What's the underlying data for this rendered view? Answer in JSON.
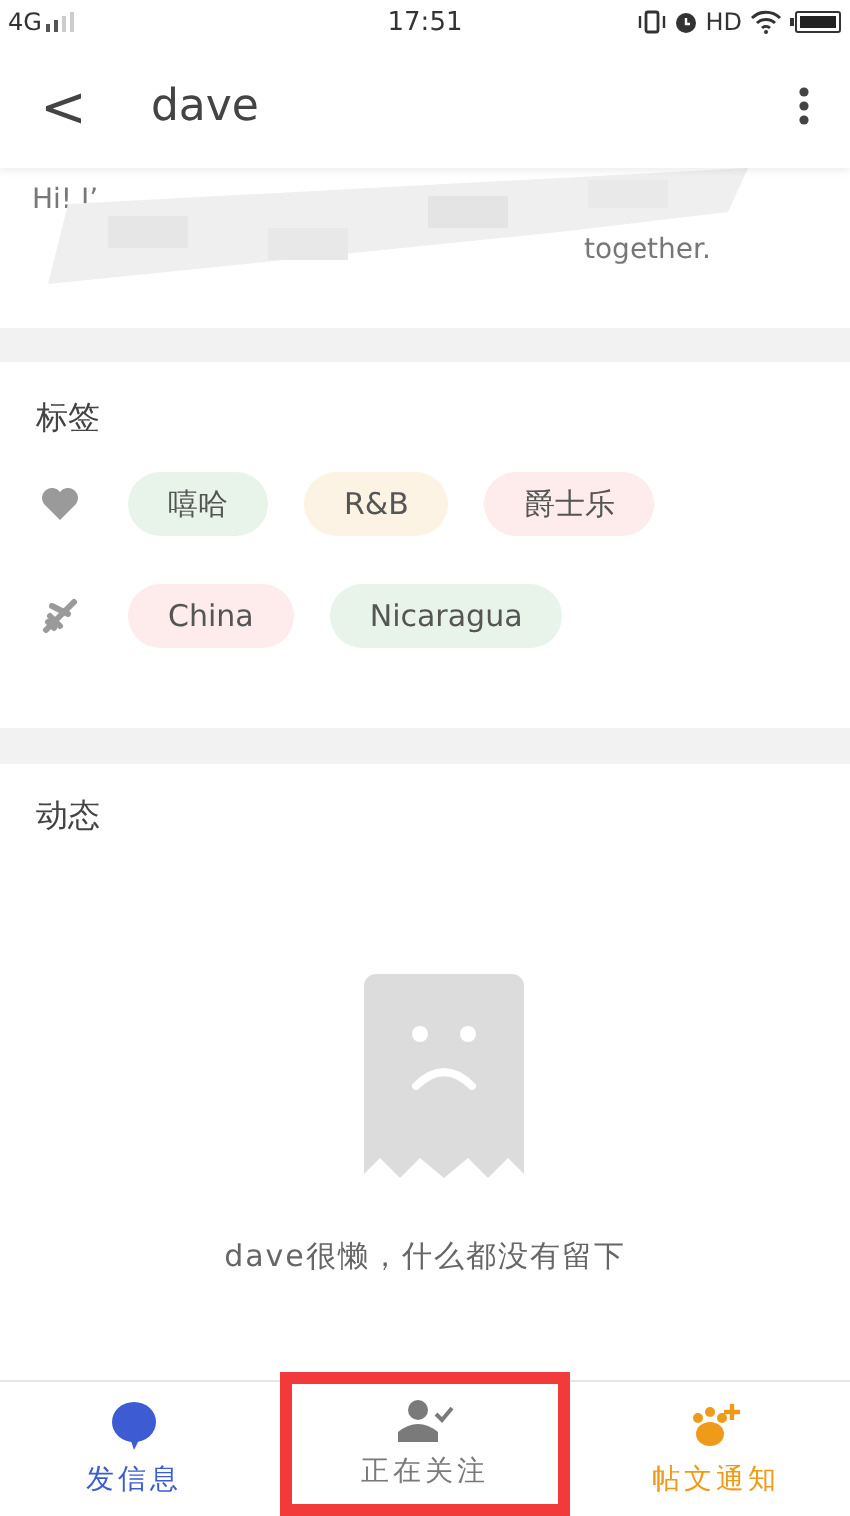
{
  "status_bar": {
    "network": "4G",
    "time": "17:51",
    "hd": "HD"
  },
  "header": {
    "back": "<",
    "title": "dave"
  },
  "bio": {
    "line_1": "Hi! I’",
    "line_2": "together."
  },
  "tags": {
    "title": "标签",
    "rows": [
      {
        "kind": "heart",
        "items": [
          {
            "label": "嘻哈",
            "color": "#e8f4ea"
          },
          {
            "label": "R&B",
            "color": "#fdf3e4"
          },
          {
            "label": "爵士乐",
            "color": "#fdeceb"
          }
        ]
      },
      {
        "kind": "plane",
        "items": [
          {
            "label": "China",
            "color": "#fdeceb"
          },
          {
            "label": "Nicaragua",
            "color": "#e8f4ea"
          }
        ]
      }
    ]
  },
  "feed": {
    "title": "动态",
    "empty_text": "dave很懒，什么都没有留下"
  },
  "bottom_nav": [
    {
      "kind": "message",
      "label": "发信息",
      "color": "#3d5bd3",
      "highlighted": false
    },
    {
      "kind": "following",
      "label": "正在关注",
      "color": "#7a7a7a",
      "highlighted": true
    },
    {
      "kind": "notify",
      "label": "帖文通知",
      "color": "#f09a1a",
      "highlighted": false
    }
  ]
}
